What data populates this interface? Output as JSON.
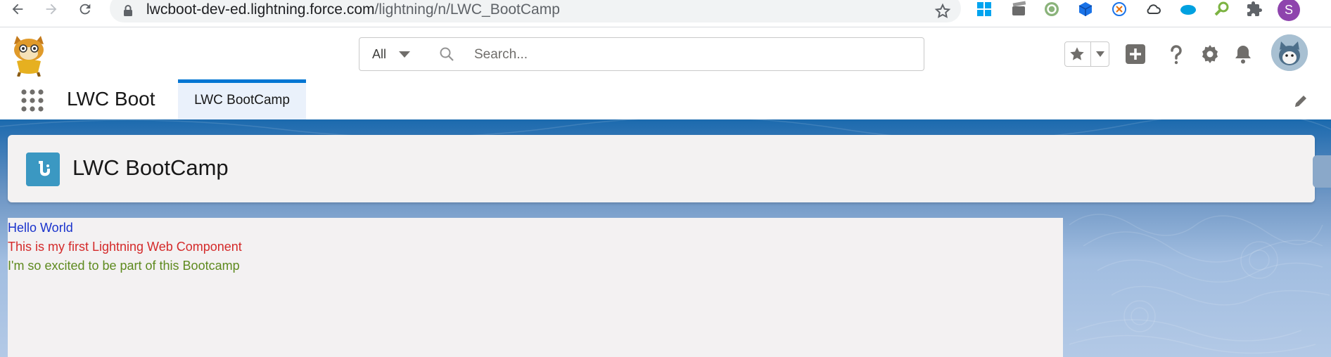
{
  "browser": {
    "url_host": "lwcboot-dev-ed.lightning.force.com",
    "url_path": "/lightning/n/LWC_BootCamp",
    "profile_initial": "S",
    "icons": [
      "back-arrow-icon",
      "forward-arrow-icon",
      "reload-icon",
      "lock-icon",
      "bookmark-star-icon",
      "windows-icon",
      "film-icon",
      "sync-icon",
      "cube-icon",
      "clock-icon",
      "cloud-icon",
      "salesforce-icon",
      "magnifier-icon",
      "puzzle-icon"
    ]
  },
  "header": {
    "search_scope": "All",
    "search_placeholder": "Search..."
  },
  "app_nav": {
    "app_name": "LWC Boot",
    "tabs": [
      {
        "label": "LWC BootCamp"
      }
    ]
  },
  "page": {
    "title": "LWC BootCamp"
  },
  "component": {
    "lines": [
      {
        "text": "Hello World",
        "color": "#1a33cc"
      },
      {
        "text": "This is my first Lightning Web Component",
        "color": "#d42a2a"
      },
      {
        "text": "I'm so excited to be part of this Bootcamp",
        "color": "#5e8a1f"
      }
    ]
  },
  "colors": {
    "brand_blue": "#0176d3",
    "page_icon": "#3b98c2"
  }
}
